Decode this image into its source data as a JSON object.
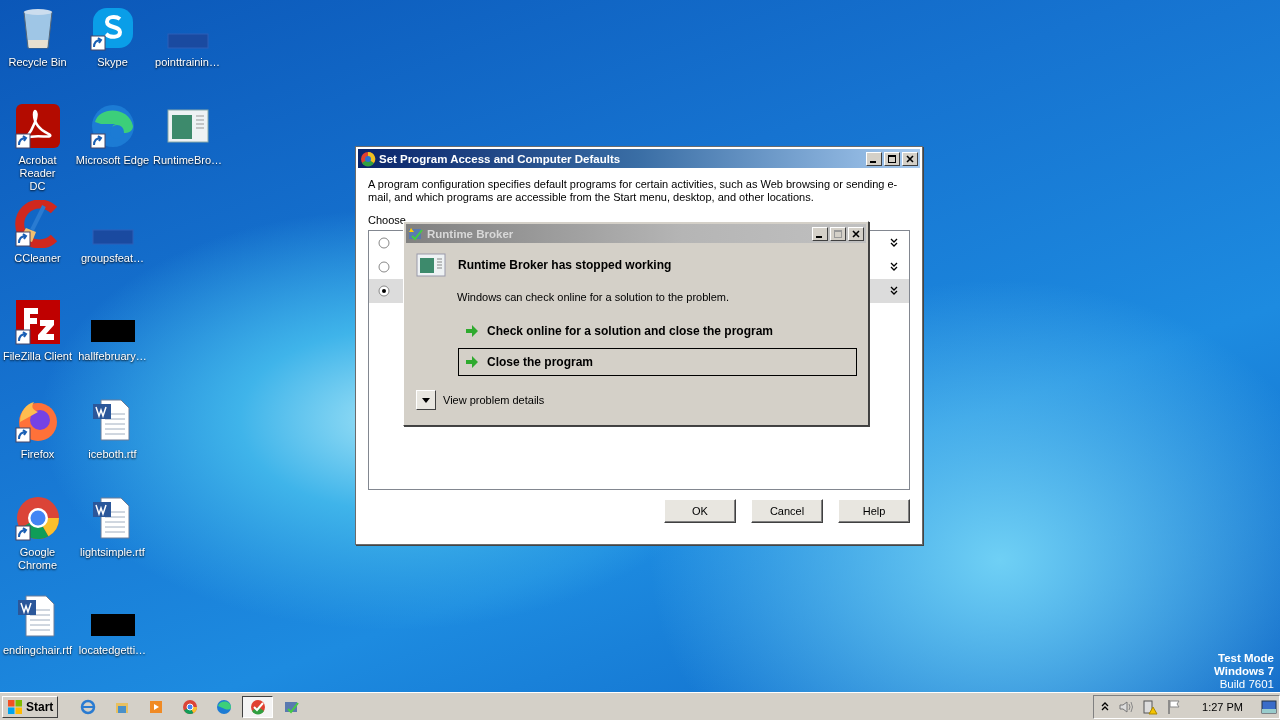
{
  "desktop": {
    "icons": [
      {
        "label": "Recycle Bin",
        "kind": "recycle",
        "shortcut": false
      },
      {
        "label": "Acrobat Reader DC",
        "kind": "acrobat",
        "shortcut": true
      },
      {
        "label": "CCleaner",
        "kind": "ccleaner",
        "shortcut": true
      },
      {
        "label": "FileZilla Client",
        "kind": "filezilla",
        "shortcut": true
      },
      {
        "label": "Firefox",
        "kind": "firefox",
        "shortcut": true
      },
      {
        "label": "Google Chrome",
        "kind": "chrome",
        "shortcut": true
      },
      {
        "label": "endingchair.rtf",
        "kind": "word",
        "shortcut": false
      },
      {
        "label": "Skype",
        "kind": "skype",
        "shortcut": true
      },
      {
        "label": "Microsoft Edge",
        "kind": "edge",
        "shortcut": true
      },
      {
        "label": "groupsfeat…",
        "kind": "blank",
        "shortcut": false
      },
      {
        "label": "hallfebruary…",
        "kind": "black",
        "shortcut": false
      },
      {
        "label": "iceboth.rtf",
        "kind": "word",
        "shortcut": false
      },
      {
        "label": "lightsimple.rtf",
        "kind": "word",
        "shortcut": false
      },
      {
        "label": "locatedgetti…",
        "kind": "black",
        "shortcut": false
      },
      {
        "label": "pointtrainin…",
        "kind": "blank",
        "shortcut": false
      },
      {
        "label": "RuntimeBro…",
        "kind": "runtime",
        "shortcut": false
      }
    ],
    "watermark_lines": [
      "Test Mode",
      "Windows 7",
      "Build 7601"
    ]
  },
  "defaults_window": {
    "title": "Set Program Access and Computer Defaults",
    "description": "A program configuration specifies default programs for certain activities, such as Web browsing or sending e-mail, and which programs are accessible from the Start menu, desktop, and other locations.",
    "choose_label": "Choose",
    "options": [
      {
        "selected": false
      },
      {
        "selected": false
      },
      {
        "selected": true
      }
    ],
    "buttons": [
      "OK",
      "Cancel",
      "Help"
    ]
  },
  "error_dialog": {
    "title": "Runtime Broker",
    "heading": "Runtime Broker has stopped working",
    "message": "Windows can check online for a solution to the problem.",
    "actions": [
      {
        "label": "Check online for a solution and close the program",
        "selected": false
      },
      {
        "label": "Close the program",
        "selected": true
      }
    ],
    "details_label": "View problem details"
  },
  "taskbar": {
    "start_label": "Start",
    "items": [
      {
        "kind": "ie",
        "selected": false
      },
      {
        "kind": "explorer",
        "selected": false
      },
      {
        "kind": "media",
        "selected": false
      },
      {
        "kind": "chrome",
        "selected": false
      },
      {
        "kind": "edge",
        "selected": false
      },
      {
        "kind": "defaults",
        "selected": true
      },
      {
        "kind": "runtime",
        "selected": false
      }
    ],
    "clock": "1:27 PM"
  }
}
